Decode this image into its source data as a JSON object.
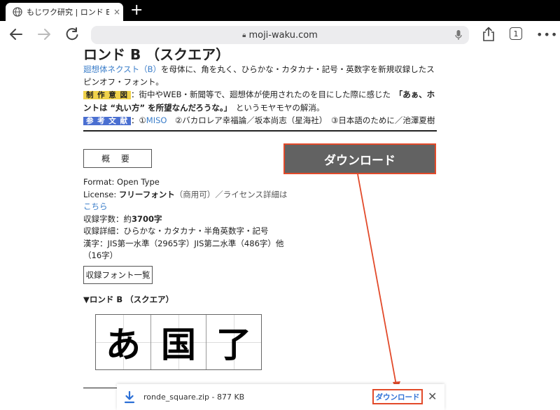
{
  "browser": {
    "tab_title": "もじワク研究 | ロンド B（ス",
    "tab_close": "×",
    "new_tab": "+",
    "url": "moji-waku.com",
    "tab_count": "1"
  },
  "page": {
    "title": "ロンド B （スクエア）",
    "desc_link": "廻想体ネクスト（B）",
    "desc_text": "を母体に、角を丸く、ひらかな・カタカナ・記号・英数字を新規収録したスピンオフ・フォント。",
    "intent_label": "制 作 意 図",
    "intent_text": "：街中やWEB・新聞等で、廻想体が使用されたのを目にした際に感じた　",
    "intent_quote": "「あぁ、ホントは “丸い方” を所望なんだろうな。」",
    "intent_tail": "　というモヤモヤの解消。",
    "ref_label": "参 考 文 献",
    "ref_sep": "：①",
    "ref_link": "MISO",
    "ref_text": "　②バカロレア幸福論／坂本尚志（星海社）　③日本語のために／池澤夏樹",
    "overview_button": "概 要",
    "format": "Format: Open Type",
    "license_prefix": "License: ",
    "license_bold": "フリーフォント",
    "license_rest": "（商用可）／ライセンス詳細は",
    "license_link": "こちら",
    "count_prefix": "収録字数：約",
    "count_bold": "3700字",
    "detail": "収録詳細：ひらかな・カタカナ・半角英数字・記号",
    "kanji": "漢字：JIS第一水準（2965字）JIS第二水準（486字）他（16字）",
    "font_list_button": "収録フォント一覧",
    "preview_title": "▼ロンド B （スクエア）",
    "glyphs": [
      "あ",
      "国",
      "了"
    ]
  },
  "annotation": {
    "label": "ダウンロード"
  },
  "download_bar": {
    "filename": "ronde_square.zip - 877 KB",
    "button": "ダウンロード",
    "close": "✕"
  }
}
